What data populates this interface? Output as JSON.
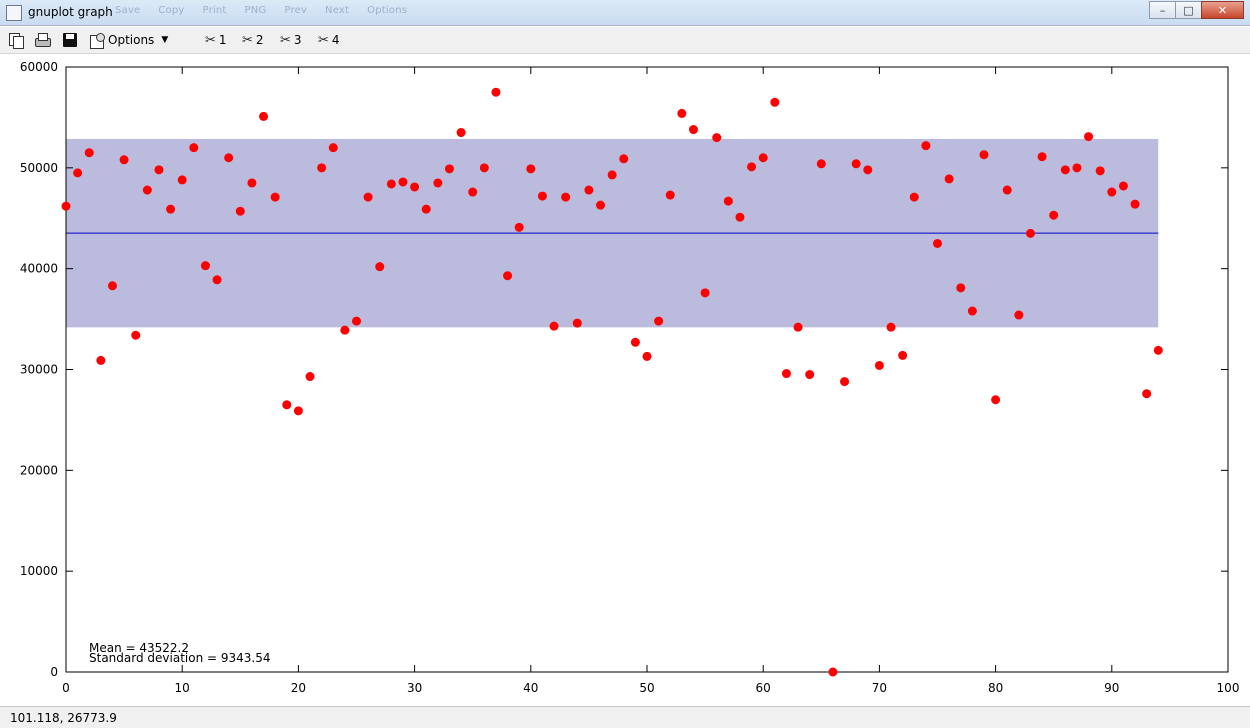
{
  "window": {
    "title": "gnuplot graph",
    "menu_faded": [
      "Save",
      "Copy",
      "Print",
      "PNG",
      "Prev",
      "Next",
      "Options"
    ]
  },
  "toolbar": {
    "icons": [
      "copy-icon",
      "print-icon",
      "save-icon",
      "options-icon"
    ],
    "options_label": "Options",
    "bookmarks": [
      "1",
      "2",
      "3",
      "4"
    ]
  },
  "colors": {
    "band": "#bbbbdd",
    "mean_line": "#0000cc",
    "points": "#ff0000",
    "axis": "#000000"
  },
  "chart_data": {
    "type": "scatter",
    "title": "",
    "xlabel": "",
    "ylabel": "",
    "xlim": [
      0,
      100
    ],
    "ylim": [
      0,
      60000
    ],
    "x_ticks": [
      0,
      10,
      20,
      30,
      40,
      50,
      60,
      70,
      80,
      90,
      100
    ],
    "y_ticks": [
      0,
      10000,
      20000,
      30000,
      40000,
      50000,
      60000
    ],
    "grid": false,
    "mean": 43522.2,
    "std_dev": 9343.54,
    "band": {
      "x": [
        0,
        94
      ],
      "y": [
        34178.66,
        52865.74
      ]
    },
    "mean_line": {
      "x": [
        0,
        94
      ],
      "y": 43522.2
    },
    "annotations": [
      "Mean = 43522.2",
      "Standard deviation = 9343.54"
    ],
    "series": [
      {
        "x": [
          0,
          1,
          2,
          3,
          4,
          5,
          6,
          7,
          8,
          9,
          10,
          11,
          12,
          13,
          14,
          15,
          16,
          17,
          18,
          19,
          20,
          21,
          22,
          23,
          24,
          25,
          26,
          27,
          28,
          29,
          30,
          31,
          32,
          33,
          34,
          35,
          36,
          37,
          38,
          39,
          40,
          41,
          42,
          43,
          44,
          45,
          46,
          47,
          48,
          49,
          50,
          51,
          52,
          53,
          54,
          55,
          56,
          57,
          58,
          59,
          60,
          61,
          62,
          63,
          64,
          65,
          66,
          67,
          68,
          69,
          70,
          71,
          72,
          73,
          74,
          75,
          76,
          77,
          78,
          79,
          80,
          81,
          82,
          83,
          84,
          85,
          86,
          87,
          88,
          89,
          90,
          91,
          92,
          93,
          94
        ],
        "y": [
          46200,
          49500,
          51500,
          30900,
          38300,
          50800,
          33400,
          47800,
          49800,
          45900,
          48800,
          52000,
          40300,
          38900,
          51000,
          45700,
          48500,
          55100,
          47100,
          26500,
          25900,
          29300,
          50000,
          52000,
          33900,
          34800,
          47100,
          40200,
          48400,
          48600,
          48100,
          45900,
          48500,
          49900,
          53500,
          47600,
          50000,
          57500,
          39300,
          44100,
          49900,
          47200,
          34300,
          47100,
          34600,
          47800,
          46300,
          49300,
          50900,
          32700,
          31300,
          34800,
          47300,
          55400,
          53800,
          37600,
          53000,
          46700,
          45100,
          50100,
          51000,
          56500,
          29600,
          34200,
          29500,
          50400,
          0,
          28800,
          50400,
          49800,
          30400,
          34200,
          31400,
          47100,
          52200,
          42500,
          48900,
          38100,
          35800,
          51300,
          27000,
          47800,
          35400,
          43500,
          51100,
          45300,
          49800,
          50000,
          53100,
          49700,
          47600,
          48200,
          46400,
          27600,
          31900
        ]
      }
    ]
  },
  "status": {
    "coords": "101.118,  26773.9"
  }
}
